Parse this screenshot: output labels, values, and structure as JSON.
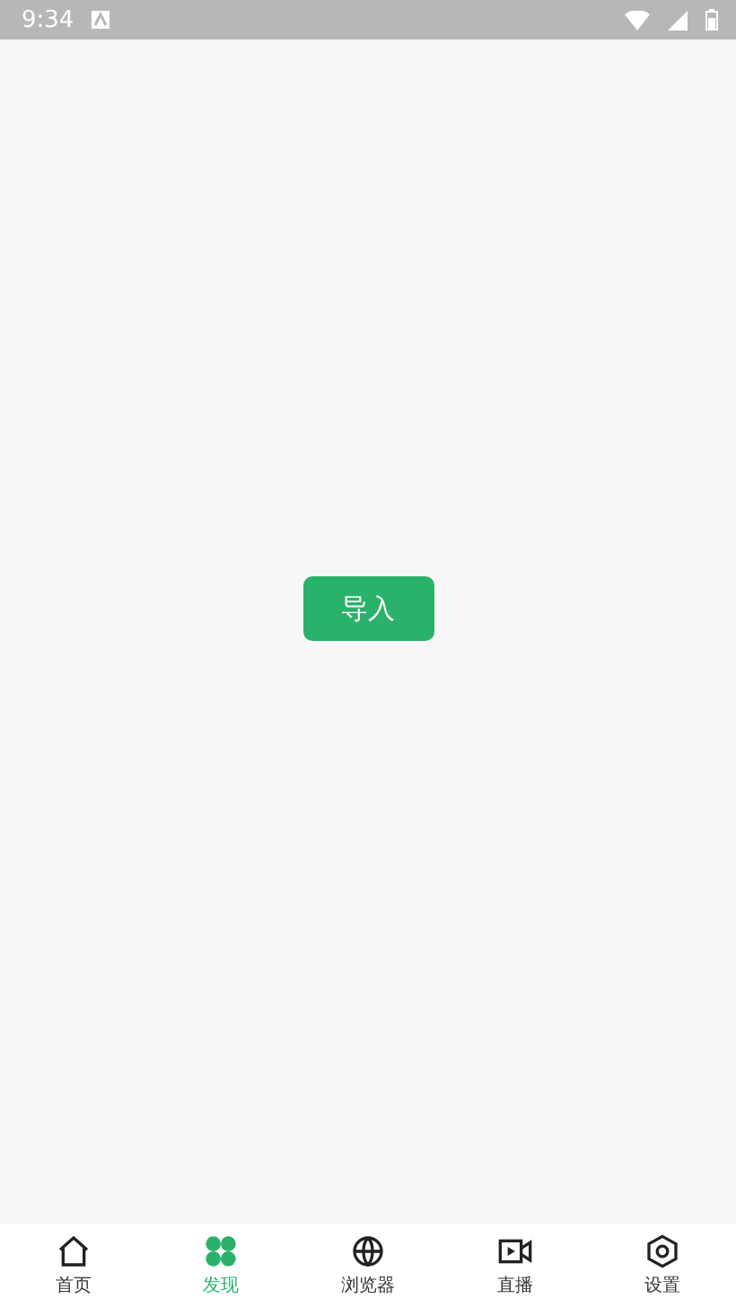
{
  "status_bar": {
    "time": "9:34"
  },
  "main": {
    "import_button": "导入"
  },
  "bottom_nav": [
    {
      "kind": "home",
      "label": "首页",
      "selected": false
    },
    {
      "kind": "discover",
      "label": "发现",
      "selected": true
    },
    {
      "kind": "browser",
      "label": "浏览器",
      "selected": false
    },
    {
      "kind": "live",
      "label": "直播",
      "selected": false
    },
    {
      "kind": "settings",
      "label": "设置",
      "selected": false
    }
  ]
}
